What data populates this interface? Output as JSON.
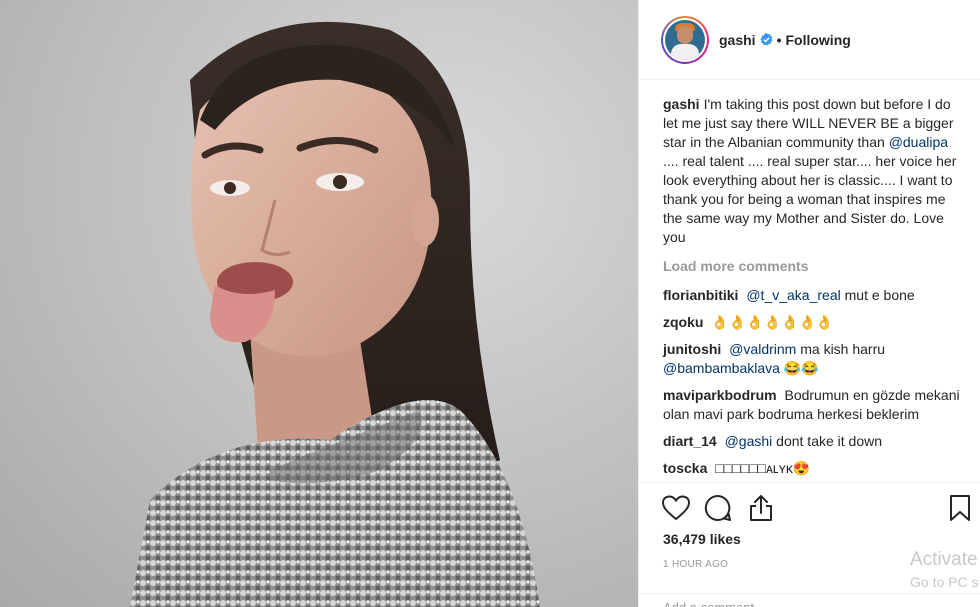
{
  "post": {
    "author": "gashi",
    "separator": "•",
    "follow_status": "Following"
  },
  "caption": {
    "username": "gashi",
    "text_before": "I'm taking this post down but before I do let me just say there WILL NEVER BE a bigger star in the Albanian community than",
    "mention": "@dualipa",
    "text_after": ".... real talent .... real super star.... her voice her look everything about her is classic.... I want to thank you for being a woman that inspires me the same way my Mother and Sister do. Love you"
  },
  "load_more": "Load more comments",
  "comments": [
    {
      "username": "florianbitiki",
      "mention": "@t_v_aka_real",
      "text": "mut e bone"
    },
    {
      "username": "zqoku",
      "mention": "",
      "text": "👌👌👌👌👌👌👌"
    },
    {
      "username": "junitoshi",
      "mention": "@valdrinm",
      "text": "ma kish harru",
      "mention2": "@bambambaklava",
      "text2": "😂😂"
    },
    {
      "username": "maviparkbodrum",
      "mention": "",
      "text": "Bodrumun en gözde mekani olan mavi park bodruma herkesi beklerim"
    },
    {
      "username": "diart_14",
      "mention": "@gashi",
      "text": "dont take it down"
    },
    {
      "username": "toscka",
      "mention": "",
      "text": "□□□□□□ᴀʟʏᴋ😍"
    }
  ],
  "likes": "36,479 likes",
  "time": "1 HOUR AGO",
  "add_comment_placeholder": "Add a comment...",
  "watermark": {
    "line1": "Activate",
    "line2": "Go to PC s"
  },
  "colors": {
    "mention": "#003569",
    "verified": "#3897f0",
    "muted": "#999999"
  }
}
